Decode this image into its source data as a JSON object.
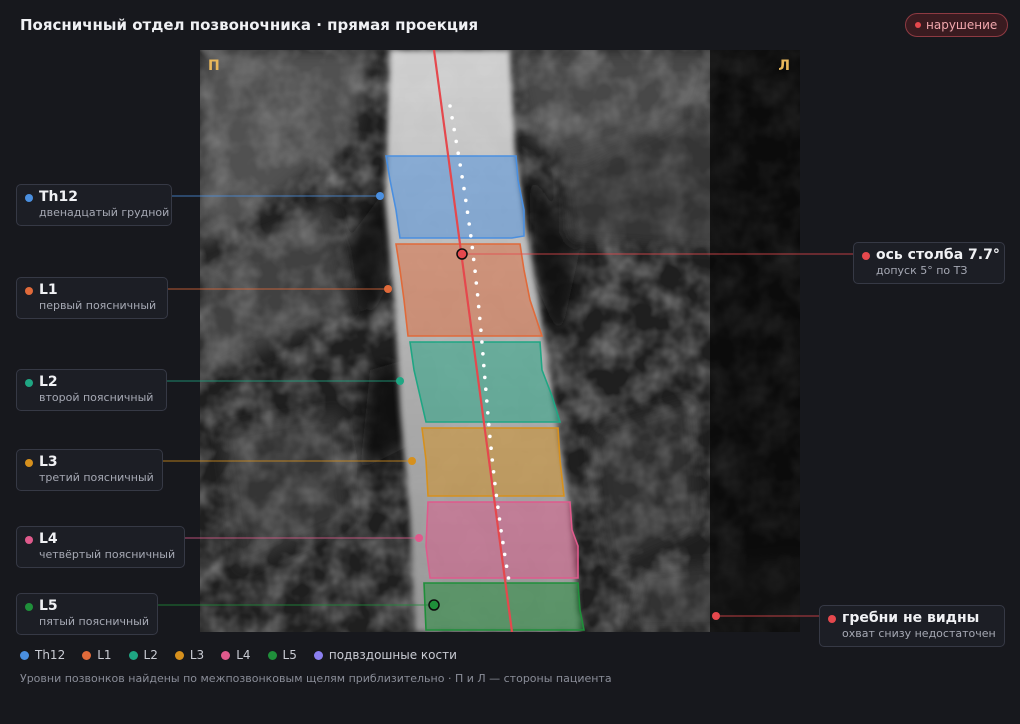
{
  "header": {
    "title": "Поясничный отдел позвоночника · прямая проекция",
    "badge": "нарушение",
    "badge_color": "#e5484d"
  },
  "viewer": {
    "left_marker": "П",
    "right_marker": "Л",
    "marker_color": "#e8b75a"
  },
  "vertebrae": [
    {
      "name": "Th12",
      "desc": "двенадцатый грудной",
      "color": "#4a8fe0"
    },
    {
      "name": "L1",
      "desc": "первый поясничный",
      "color": "#e06a3a"
    },
    {
      "name": "L2",
      "desc": "второй поясничный",
      "color": "#1fa683"
    },
    {
      "name": "L3",
      "desc": "третий поясничный",
      "color": "#d6901d"
    },
    {
      "name": "L4",
      "desc": "четвёртый поясничный",
      "color": "#df5a8c"
    },
    {
      "name": "L5",
      "desc": "пятый поясничный",
      "color": "#1f8f3a"
    }
  ],
  "axis_card": {
    "label": "ось столба 7.7°",
    "desc": "допуск 5° по ТЗ",
    "color": "#e5484d",
    "angle_deg": 7.7,
    "tolerance_deg": 5
  },
  "crest_card": {
    "label": "гребни не видны",
    "desc": "охват снизу недостаточен",
    "color": "#e5484d"
  },
  "legend": [
    {
      "label": "Th12",
      "color": "#4a8fe0"
    },
    {
      "label": "L1",
      "color": "#e06a3a"
    },
    {
      "label": "L2",
      "color": "#1fa683"
    },
    {
      "label": "L3",
      "color": "#d6901d"
    },
    {
      "label": "L4",
      "color": "#df5a8c"
    },
    {
      "label": "L5",
      "color": "#1f8f3a"
    },
    {
      "label": "подвздошные кости",
      "color": "#8b7ff0"
    }
  ],
  "footnote": "Уровни позвонков найдены по межпозвонковым щелям приблизительно · П и Л — стороны пациента"
}
